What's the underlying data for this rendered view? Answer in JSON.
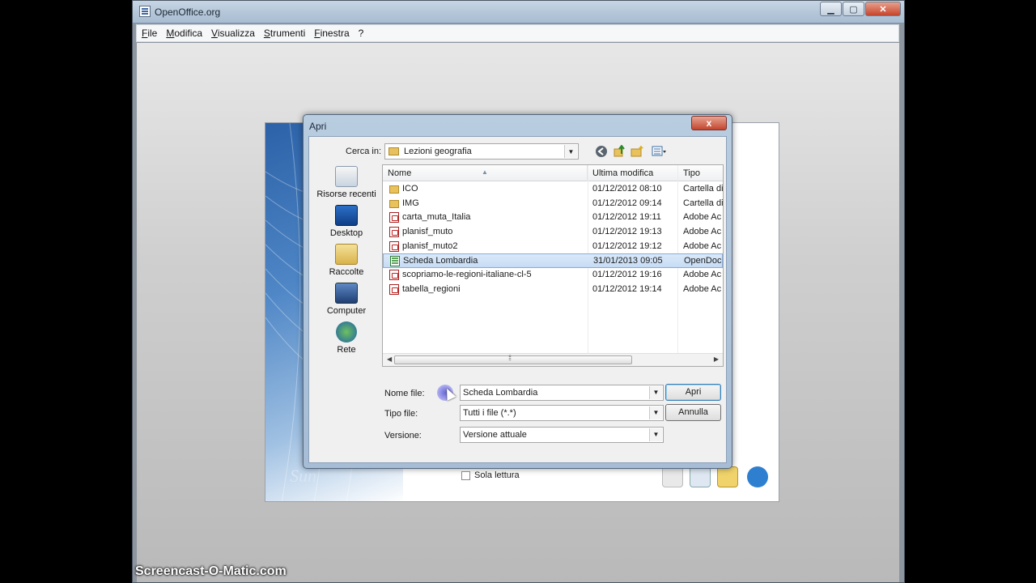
{
  "app": {
    "title": "OpenOffice.org"
  },
  "menu": [
    "File",
    "Modifica",
    "Visualizza",
    "Strumenti",
    "Finestra",
    "?"
  ],
  "start_center": {
    "brand": "Sun"
  },
  "dialog": {
    "title": "Apri",
    "close_label": "x",
    "look_in_label": "Cerca in:",
    "look_in_value": "Lezioni geografia",
    "places": [
      {
        "label": "Risorse recenti",
        "icon": "recent-icon"
      },
      {
        "label": "Desktop",
        "icon": "desktop-icon"
      },
      {
        "label": "Raccolte",
        "icon": "libraries-icon"
      },
      {
        "label": "Computer",
        "icon": "computer-icon"
      },
      {
        "label": "Rete",
        "icon": "network-icon"
      }
    ],
    "columns": {
      "name": "Nome",
      "date": "Ultima modifica",
      "type": "Tipo"
    },
    "files": [
      {
        "name": "ICO",
        "date": "01/12/2012 08:10",
        "type": "Cartella di",
        "icon": "folder"
      },
      {
        "name": "IMG",
        "date": "01/12/2012 09:14",
        "type": "Cartella di",
        "icon": "folder"
      },
      {
        "name": "carta_muta_Italia",
        "date": "01/12/2012 19:11",
        "type": "Adobe Ac",
        "icon": "pdf"
      },
      {
        "name": "planisf_muto",
        "date": "01/12/2012 19:13",
        "type": "Adobe Ac",
        "icon": "pdf"
      },
      {
        "name": "planisf_muto2",
        "date": "01/12/2012 19:12",
        "type": "Adobe Ac",
        "icon": "pdf"
      },
      {
        "name": "Scheda Lombardia",
        "date": "31/01/2013 09:05",
        "type": "OpenDoc",
        "icon": "odt",
        "selected": true
      },
      {
        "name": "scopriamo-le-regioni-italiane-cl-5",
        "date": "01/12/2012 19:16",
        "type": "Adobe Ac",
        "icon": "pdf"
      },
      {
        "name": "tabella_regioni",
        "date": "01/12/2012 19:14",
        "type": "Adobe Ac",
        "icon": "pdf"
      }
    ],
    "file_name_label": "Nome file:",
    "file_name_value": "Scheda Lombardia",
    "file_type_label": "Tipo file:",
    "file_type_value": "Tutti i file (*.*)",
    "version_label": "Versione:",
    "version_value": "Versione attuale",
    "open_button": "Apri",
    "cancel_button": "Annulla",
    "readonly_label": "Sola lettura"
  },
  "watermark": "Screencast-O-Matic.com"
}
